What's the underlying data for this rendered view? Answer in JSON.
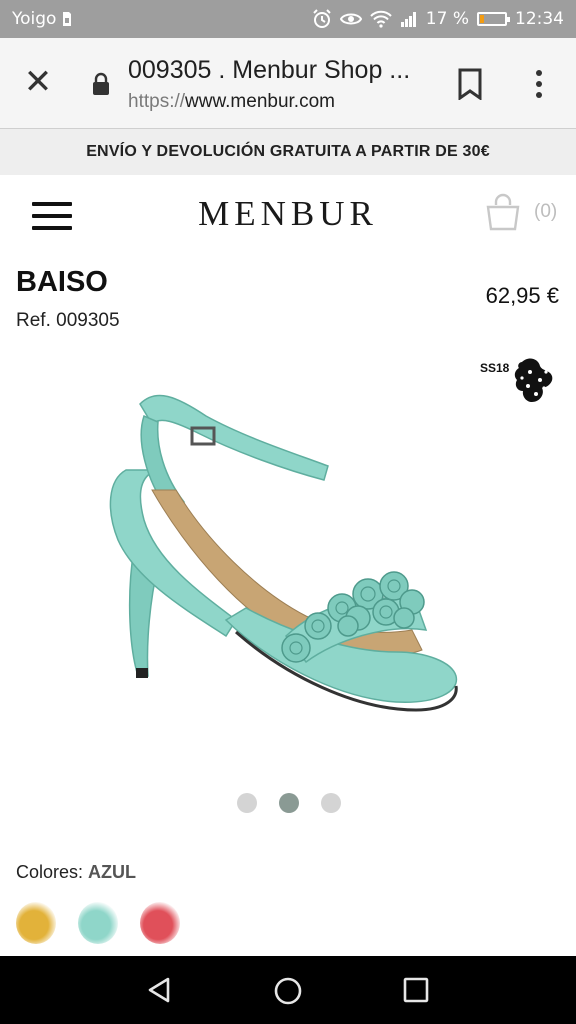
{
  "status": {
    "carrier": "Yoigo",
    "battery_pct": "17 %",
    "battery_level": 0.17,
    "time": "12:34",
    "battery_color": "#f39c12"
  },
  "browser": {
    "title": "009305 . Menbur Shop ...",
    "url_scheme": "https://",
    "url_host": "www.menbur.com"
  },
  "promo": {
    "text": "ENVÍO Y DEVOLUCIÓN GRATUITA A PARTIR DE 30€"
  },
  "header": {
    "logo": "MENBUR",
    "cart_count": "(0)"
  },
  "product": {
    "name": "BAISO",
    "ref": "Ref. 009305",
    "price": "62,95 €",
    "season_badge": "SS18",
    "shoe_color": "#8fd6c9"
  },
  "carousel": {
    "total": 3,
    "active_index": 1
  },
  "colors": {
    "label": "Colores: ",
    "selected": "AZUL",
    "swatches": [
      {
        "icon": "gold-swatch",
        "color": "#e2b23a"
      },
      {
        "icon": "aqua-swatch",
        "color": "#8fd6c9"
      },
      {
        "icon": "red-swatch",
        "color": "#e0505a"
      }
    ]
  },
  "nav": {
    "icons": [
      "back-icon",
      "home-icon",
      "recents-icon"
    ]
  }
}
